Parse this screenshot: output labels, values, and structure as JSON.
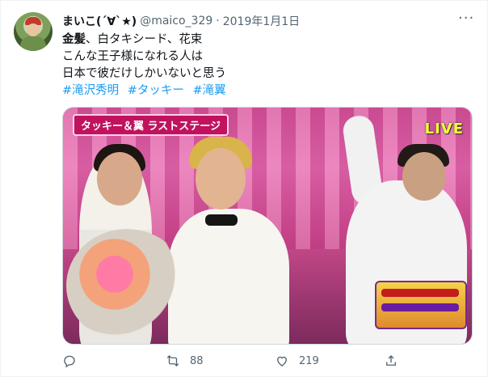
{
  "tweet": {
    "display_name": "まいこ(´∀`★)",
    "handle": "@maico_329",
    "separator": "·",
    "date": "2019年1月1日",
    "lines": [
      "金髪、白タキシード、花束",
      "こんな王子様になれる人は",
      "日本で彼だけしかいないと思う"
    ],
    "bold_prefix": "金髪",
    "line1_rest": "、白タキシード、花束",
    "hashtags": [
      "#滝沢秀明",
      "#タッキー",
      "#滝翼"
    ]
  },
  "media": {
    "top_left_caption": "タッキー＆翼 ラストステージ",
    "live_label": "LIVE",
    "icon": "photo"
  },
  "actions": {
    "reply_count": "",
    "retweet_count": "88",
    "like_count": "219",
    "reply_icon": "reply-icon",
    "retweet_icon": "retweet-icon",
    "like_icon": "heart-icon",
    "share_icon": "share-icon"
  },
  "colors": {
    "link": "#1d9bf0",
    "muted": "#536471"
  }
}
